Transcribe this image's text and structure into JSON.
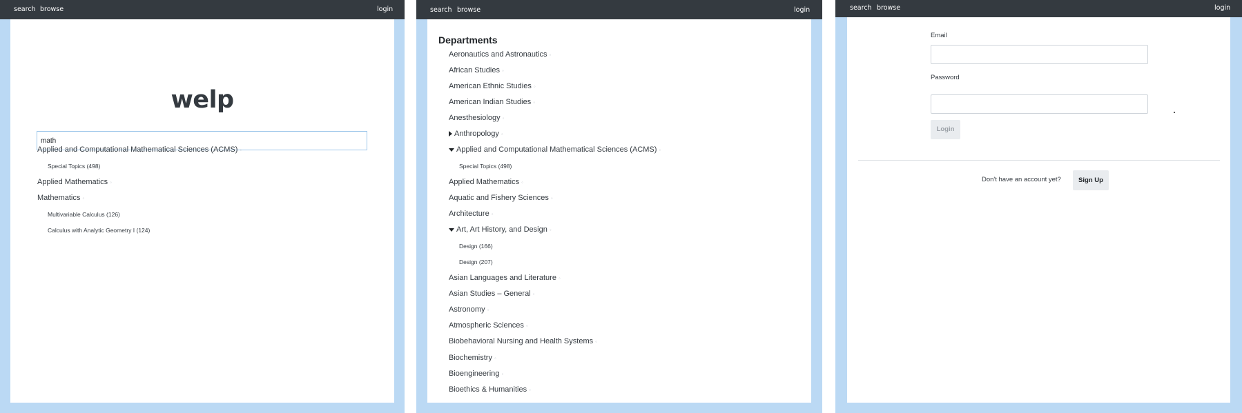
{
  "nav": {
    "search": "search",
    "browse": "browse",
    "login": "login"
  },
  "search_view": {
    "logo": "welp",
    "search_value": "math",
    "results": [
      {
        "label": "Applied and Computational Mathematical Sciences (ACMS)",
        "level": "dept"
      },
      {
        "label": "Special Topics (498)",
        "level": "course"
      },
      {
        "label": "Applied Mathematics",
        "level": "dept"
      },
      {
        "label": "Mathematics",
        "level": "dept"
      },
      {
        "label": "Multivariable Calculus (126)",
        "level": "course"
      },
      {
        "label": "Calculus with Analytic Geometry I (124)",
        "level": "course"
      }
    ]
  },
  "browse_view": {
    "heading": "Departments",
    "items": [
      {
        "label": "Aeronautics and Astronautics",
        "level": "dept",
        "toggle": ""
      },
      {
        "label": "African Studies",
        "level": "dept",
        "toggle": ""
      },
      {
        "label": "American Ethnic Studies",
        "level": "dept",
        "toggle": ""
      },
      {
        "label": "American Indian Studies",
        "level": "dept",
        "toggle": ""
      },
      {
        "label": "Anesthesiology",
        "level": "dept",
        "toggle": ""
      },
      {
        "label": "Anthropology",
        "level": "dept",
        "toggle": "collapsed"
      },
      {
        "label": "Applied and Computational Mathematical Sciences (ACMS)",
        "level": "dept",
        "toggle": "expanded"
      },
      {
        "label": "Special Topics (498)",
        "level": "course",
        "toggle": ""
      },
      {
        "label": "Applied Mathematics",
        "level": "dept",
        "toggle": ""
      },
      {
        "label": "Aquatic and Fishery Sciences",
        "level": "dept",
        "toggle": ""
      },
      {
        "label": "Architecture",
        "level": "dept",
        "toggle": ""
      },
      {
        "label": "Art, Art History, and Design",
        "level": "dept",
        "toggle": "expanded"
      },
      {
        "label": "Design (166)",
        "level": "course",
        "toggle": ""
      },
      {
        "label": "Design (207)",
        "level": "course",
        "toggle": ""
      },
      {
        "label": "Asian Languages and Literature",
        "level": "dept",
        "toggle": ""
      },
      {
        "label": "Asian Studies – General",
        "level": "dept",
        "toggle": ""
      },
      {
        "label": "Astronomy",
        "level": "dept",
        "toggle": ""
      },
      {
        "label": "Atmospheric Sciences",
        "level": "dept",
        "toggle": ""
      },
      {
        "label": "Biobehavioral Nursing and Health Systems",
        "level": "dept",
        "toggle": ""
      },
      {
        "label": "Biochemistry",
        "level": "dept",
        "toggle": ""
      },
      {
        "label": "Bioengineering",
        "level": "dept",
        "toggle": ""
      },
      {
        "label": "Bioethics & Humanities",
        "level": "dept",
        "toggle": ""
      }
    ]
  },
  "login_view": {
    "email_label": "Email",
    "password_label": "Password",
    "login_button": "Login",
    "no_account_text": "Don't have an account yet?",
    "signup_button": "Sign Up"
  }
}
